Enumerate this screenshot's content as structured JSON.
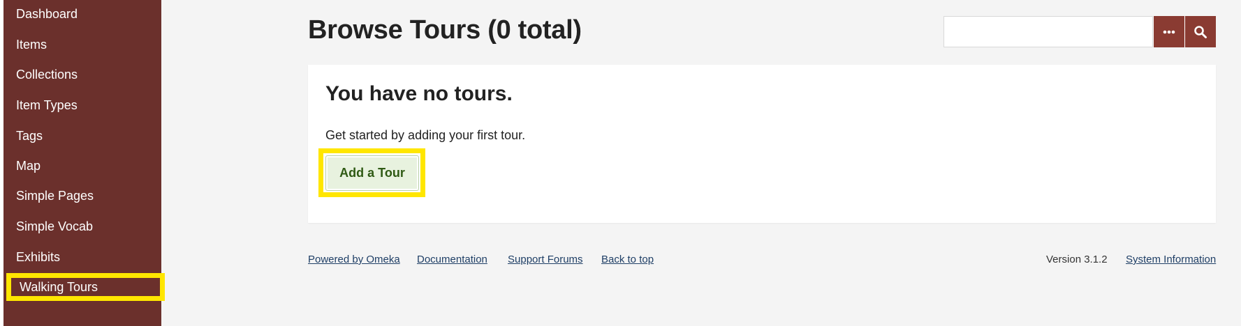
{
  "sidebar": {
    "items": [
      {
        "label": "Dashboard"
      },
      {
        "label": "Items"
      },
      {
        "label": "Collections"
      },
      {
        "label": "Item Types"
      },
      {
        "label": "Tags"
      },
      {
        "label": "Map"
      },
      {
        "label": "Simple Pages"
      },
      {
        "label": "Simple Vocab"
      },
      {
        "label": "Exhibits"
      },
      {
        "label": "Walking Tours",
        "active": true
      }
    ]
  },
  "header": {
    "title": "Browse Tours (0 total)",
    "search": {
      "value": "",
      "placeholder": ""
    }
  },
  "panel": {
    "heading": "You have no tours.",
    "text": "Get started by adding your first tour.",
    "add_button": "Add a Tour"
  },
  "footer": {
    "links": [
      "Powered by Omeka",
      "Documentation",
      "Support Forums",
      "Back to top"
    ],
    "version": "Version 3.1.2",
    "system_info": "System Information"
  },
  "colors": {
    "sidebar_bg": "#6b302c",
    "search_button_bg": "#8a3b32",
    "highlight": "#ffe600",
    "add_button_bg": "#e8f2df",
    "add_button_text": "#2f5a14",
    "link": "#1f3f66"
  },
  "icons": {
    "search_options": "ellipsis-icon",
    "search_submit": "search-icon"
  }
}
